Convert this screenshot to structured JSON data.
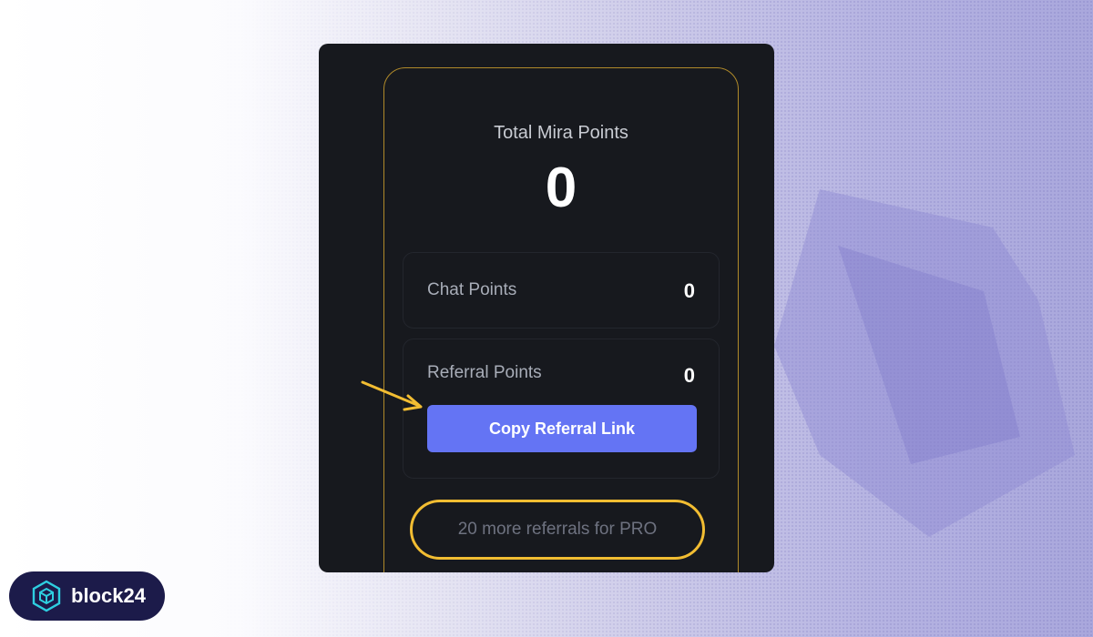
{
  "card": {
    "total_label": "Total Mira Points",
    "total_value": "0"
  },
  "chat": {
    "label": "Chat Points",
    "value": "0"
  },
  "referral": {
    "label": "Referral Points",
    "value": "0",
    "copy_button_label": "Copy Referral Link"
  },
  "pro_status": "20 more referrals for PRO",
  "brand": {
    "name": "block24"
  },
  "colors": {
    "card_border": "#b08a2a",
    "button": "#6474f4",
    "highlight": "#f2bd32"
  }
}
